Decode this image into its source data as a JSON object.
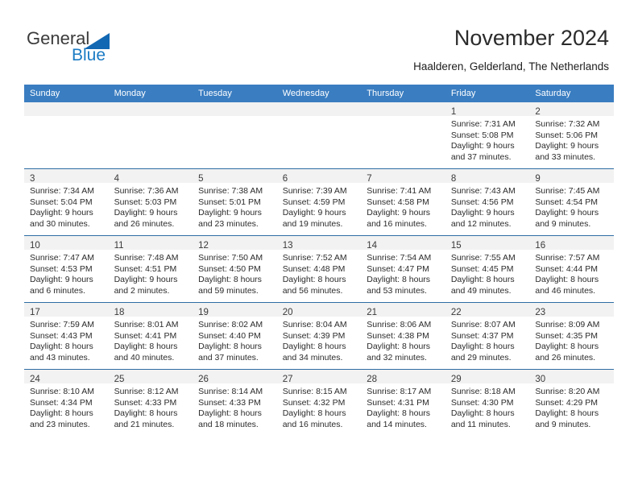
{
  "brand": {
    "name_top": "General",
    "name_bottom": "Blue",
    "accent_color": "#1268b3"
  },
  "header": {
    "title": "November 2024",
    "subtitle": "Haalderen, Gelderland, The Netherlands"
  },
  "calendar": {
    "header_background": "#3a7dc1",
    "weekdays": [
      "Sunday",
      "Monday",
      "Tuesday",
      "Wednesday",
      "Thursday",
      "Friday",
      "Saturday"
    ],
    "weeks": [
      [
        {
          "empty": true
        },
        {
          "empty": true
        },
        {
          "empty": true
        },
        {
          "empty": true
        },
        {
          "empty": true
        },
        {
          "day": "1",
          "sunrise": "Sunrise: 7:31 AM",
          "sunset": "Sunset: 5:08 PM",
          "daylight1": "Daylight: 9 hours",
          "daylight2": "and 37 minutes."
        },
        {
          "day": "2",
          "sunrise": "Sunrise: 7:32 AM",
          "sunset": "Sunset: 5:06 PM",
          "daylight1": "Daylight: 9 hours",
          "daylight2": "and 33 minutes."
        }
      ],
      [
        {
          "day": "3",
          "sunrise": "Sunrise: 7:34 AM",
          "sunset": "Sunset: 5:04 PM",
          "daylight1": "Daylight: 9 hours",
          "daylight2": "and 30 minutes."
        },
        {
          "day": "4",
          "sunrise": "Sunrise: 7:36 AM",
          "sunset": "Sunset: 5:03 PM",
          "daylight1": "Daylight: 9 hours",
          "daylight2": "and 26 minutes."
        },
        {
          "day": "5",
          "sunrise": "Sunrise: 7:38 AM",
          "sunset": "Sunset: 5:01 PM",
          "daylight1": "Daylight: 9 hours",
          "daylight2": "and 23 minutes."
        },
        {
          "day": "6",
          "sunrise": "Sunrise: 7:39 AM",
          "sunset": "Sunset: 4:59 PM",
          "daylight1": "Daylight: 9 hours",
          "daylight2": "and 19 minutes."
        },
        {
          "day": "7",
          "sunrise": "Sunrise: 7:41 AM",
          "sunset": "Sunset: 4:58 PM",
          "daylight1": "Daylight: 9 hours",
          "daylight2": "and 16 minutes."
        },
        {
          "day": "8",
          "sunrise": "Sunrise: 7:43 AM",
          "sunset": "Sunset: 4:56 PM",
          "daylight1": "Daylight: 9 hours",
          "daylight2": "and 12 minutes."
        },
        {
          "day": "9",
          "sunrise": "Sunrise: 7:45 AM",
          "sunset": "Sunset: 4:54 PM",
          "daylight1": "Daylight: 9 hours",
          "daylight2": "and 9 minutes."
        }
      ],
      [
        {
          "day": "10",
          "sunrise": "Sunrise: 7:47 AM",
          "sunset": "Sunset: 4:53 PM",
          "daylight1": "Daylight: 9 hours",
          "daylight2": "and 6 minutes."
        },
        {
          "day": "11",
          "sunrise": "Sunrise: 7:48 AM",
          "sunset": "Sunset: 4:51 PM",
          "daylight1": "Daylight: 9 hours",
          "daylight2": "and 2 minutes."
        },
        {
          "day": "12",
          "sunrise": "Sunrise: 7:50 AM",
          "sunset": "Sunset: 4:50 PM",
          "daylight1": "Daylight: 8 hours",
          "daylight2": "and 59 minutes."
        },
        {
          "day": "13",
          "sunrise": "Sunrise: 7:52 AM",
          "sunset": "Sunset: 4:48 PM",
          "daylight1": "Daylight: 8 hours",
          "daylight2": "and 56 minutes."
        },
        {
          "day": "14",
          "sunrise": "Sunrise: 7:54 AM",
          "sunset": "Sunset: 4:47 PM",
          "daylight1": "Daylight: 8 hours",
          "daylight2": "and 53 minutes."
        },
        {
          "day": "15",
          "sunrise": "Sunrise: 7:55 AM",
          "sunset": "Sunset: 4:45 PM",
          "daylight1": "Daylight: 8 hours",
          "daylight2": "and 49 minutes."
        },
        {
          "day": "16",
          "sunrise": "Sunrise: 7:57 AM",
          "sunset": "Sunset: 4:44 PM",
          "daylight1": "Daylight: 8 hours",
          "daylight2": "and 46 minutes."
        }
      ],
      [
        {
          "day": "17",
          "sunrise": "Sunrise: 7:59 AM",
          "sunset": "Sunset: 4:43 PM",
          "daylight1": "Daylight: 8 hours",
          "daylight2": "and 43 minutes."
        },
        {
          "day": "18",
          "sunrise": "Sunrise: 8:01 AM",
          "sunset": "Sunset: 4:41 PM",
          "daylight1": "Daylight: 8 hours",
          "daylight2": "and 40 minutes."
        },
        {
          "day": "19",
          "sunrise": "Sunrise: 8:02 AM",
          "sunset": "Sunset: 4:40 PM",
          "daylight1": "Daylight: 8 hours",
          "daylight2": "and 37 minutes."
        },
        {
          "day": "20",
          "sunrise": "Sunrise: 8:04 AM",
          "sunset": "Sunset: 4:39 PM",
          "daylight1": "Daylight: 8 hours",
          "daylight2": "and 34 minutes."
        },
        {
          "day": "21",
          "sunrise": "Sunrise: 8:06 AM",
          "sunset": "Sunset: 4:38 PM",
          "daylight1": "Daylight: 8 hours",
          "daylight2": "and 32 minutes."
        },
        {
          "day": "22",
          "sunrise": "Sunrise: 8:07 AM",
          "sunset": "Sunset: 4:37 PM",
          "daylight1": "Daylight: 8 hours",
          "daylight2": "and 29 minutes."
        },
        {
          "day": "23",
          "sunrise": "Sunrise: 8:09 AM",
          "sunset": "Sunset: 4:35 PM",
          "daylight1": "Daylight: 8 hours",
          "daylight2": "and 26 minutes."
        }
      ],
      [
        {
          "day": "24",
          "sunrise": "Sunrise: 8:10 AM",
          "sunset": "Sunset: 4:34 PM",
          "daylight1": "Daylight: 8 hours",
          "daylight2": "and 23 minutes."
        },
        {
          "day": "25",
          "sunrise": "Sunrise: 8:12 AM",
          "sunset": "Sunset: 4:33 PM",
          "daylight1": "Daylight: 8 hours",
          "daylight2": "and 21 minutes."
        },
        {
          "day": "26",
          "sunrise": "Sunrise: 8:14 AM",
          "sunset": "Sunset: 4:33 PM",
          "daylight1": "Daylight: 8 hours",
          "daylight2": "and 18 minutes."
        },
        {
          "day": "27",
          "sunrise": "Sunrise: 8:15 AM",
          "sunset": "Sunset: 4:32 PM",
          "daylight1": "Daylight: 8 hours",
          "daylight2": "and 16 minutes."
        },
        {
          "day": "28",
          "sunrise": "Sunrise: 8:17 AM",
          "sunset": "Sunset: 4:31 PM",
          "daylight1": "Daylight: 8 hours",
          "daylight2": "and 14 minutes."
        },
        {
          "day": "29",
          "sunrise": "Sunrise: 8:18 AM",
          "sunset": "Sunset: 4:30 PM",
          "daylight1": "Daylight: 8 hours",
          "daylight2": "and 11 minutes."
        },
        {
          "day": "30",
          "sunrise": "Sunrise: 8:20 AM",
          "sunset": "Sunset: 4:29 PM",
          "daylight1": "Daylight: 8 hours",
          "daylight2": "and 9 minutes."
        }
      ]
    ]
  }
}
